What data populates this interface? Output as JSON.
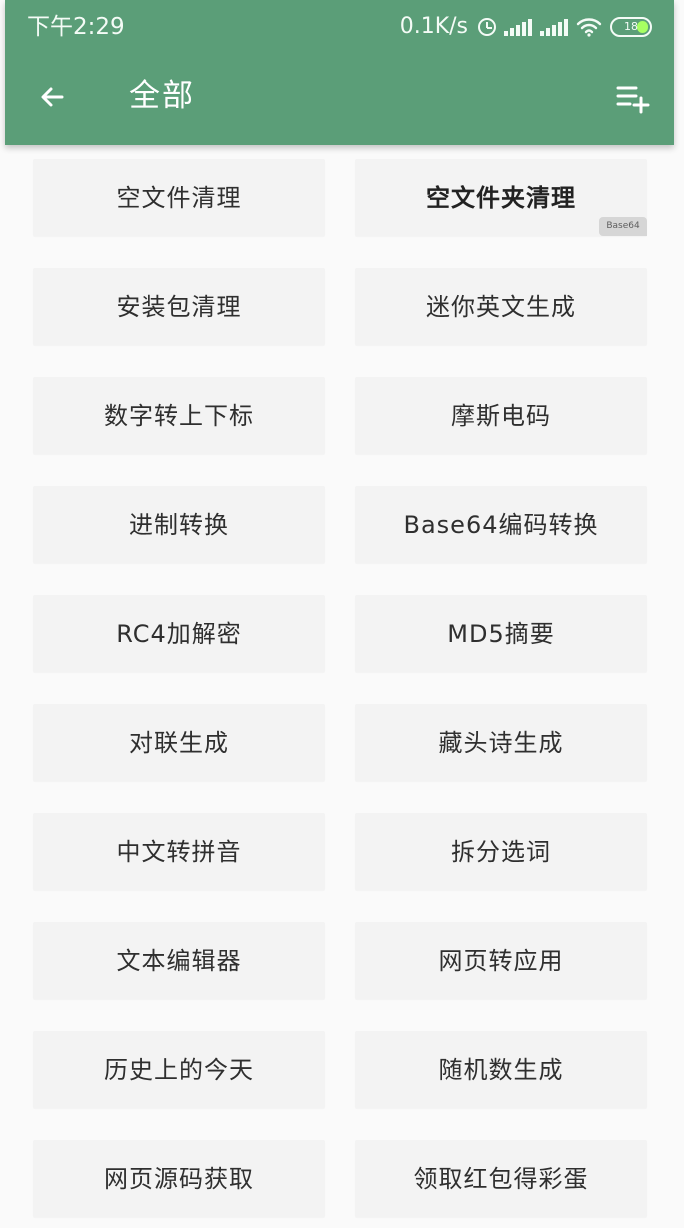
{
  "status_bar": {
    "time": "下午2:29",
    "network_speed": "0.1K/s",
    "battery_level": "18",
    "icons": [
      "alarm-icon",
      "signal-icon",
      "signal-icon",
      "wifi-icon",
      "battery-icon"
    ]
  },
  "header": {
    "title": "全部",
    "back_icon": "back-arrow-icon",
    "action_icon": "playlist-add-icon"
  },
  "tools": [
    {
      "label": "空文件清理"
    },
    {
      "label": "空文件夹清理",
      "badge": "Base64"
    },
    {
      "label": "安装包清理"
    },
    {
      "label": "迷你英文生成"
    },
    {
      "label": "数字转上下标"
    },
    {
      "label": "摩斯电码"
    },
    {
      "label": "进制转换"
    },
    {
      "label": "Base64编码转换"
    },
    {
      "label": "RC4加解密"
    },
    {
      "label": "MD5摘要"
    },
    {
      "label": "对联生成"
    },
    {
      "label": "藏头诗生成"
    },
    {
      "label": "中文转拼音"
    },
    {
      "label": "拆分选词"
    },
    {
      "label": "文本编辑器"
    },
    {
      "label": "网页转应用"
    },
    {
      "label": "历史上的今天"
    },
    {
      "label": "随机数生成"
    },
    {
      "label": "网页源码获取"
    },
    {
      "label": "领取红包得彩蛋"
    }
  ],
  "colors": {
    "app_bar": "#5b9e78",
    "background": "#fafafa",
    "card": "#f3f3f3",
    "text": "#2f2f2f",
    "battery_fill": "#a7ff62"
  }
}
